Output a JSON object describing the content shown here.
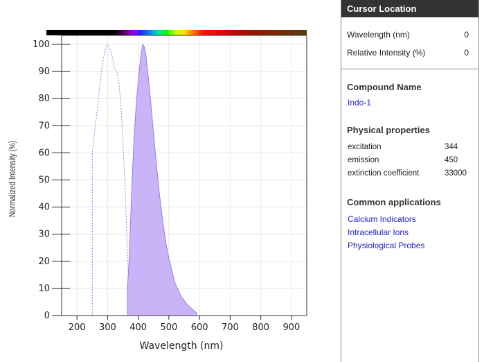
{
  "chart_data": {
    "type": "area",
    "xlabel": "Wavelength (nm)",
    "ylabel": "Normalized Intensity (%)",
    "xlim": [
      150,
      950
    ],
    "ylim": [
      0,
      100
    ],
    "xticks": [
      200,
      300,
      400,
      500,
      600,
      700,
      800,
      900
    ],
    "yticks": [
      0,
      10,
      20,
      30,
      40,
      50,
      60,
      70,
      80,
      90,
      100
    ],
    "grid": true,
    "spectrum_bar": true,
    "series": [
      {
        "style": "dotted-line",
        "color": "#9a7ae8",
        "x": [
          250,
          250,
          255,
          262,
          270,
          280,
          290,
          298,
          305,
          312,
          318,
          322,
          330,
          338,
          345,
          352,
          358,
          362,
          365,
          368,
          372,
          378,
          385,
          392,
          400,
          408
        ],
        "y": [
          0,
          60,
          65,
          72,
          80,
          90,
          97,
          100,
          99,
          97,
          94,
          91,
          90,
          85,
          75,
          60,
          45,
          32,
          22,
          14,
          8,
          4,
          2,
          1,
          0.5,
          0
        ]
      },
      {
        "style": "filled-area",
        "color": "#9a7ae8",
        "fill": "#c9b4f8",
        "x": [
          365,
          365,
          370,
          375,
          380,
          385,
          390,
          395,
          400,
          405,
          410,
          415,
          420,
          425,
          430,
          440,
          450,
          460,
          470,
          480,
          490,
          500,
          520,
          540,
          560,
          580,
          590,
          590
        ],
        "y": [
          0,
          10,
          20,
          35,
          50,
          62,
          72,
          80,
          86,
          92,
          97,
          100,
          99,
          96,
          91,
          80,
          67,
          55,
          44,
          35,
          27,
          21,
          12,
          7,
          4,
          2,
          1,
          0
        ]
      }
    ]
  },
  "cursor": {
    "title": "Cursor Location",
    "wavelength_label": "Wavelength (nm)",
    "wavelength_value": "0",
    "intensity_label": "Relative Intensity (%)",
    "intensity_value": "0"
  },
  "compound": {
    "title": "Compound Name",
    "name": "Indo-1"
  },
  "physical": {
    "title": "Physical properties",
    "rows": [
      {
        "label": "excitation",
        "value": "344"
      },
      {
        "label": "emission",
        "value": "450"
      },
      {
        "label": "extinction coefficient",
        "value": "33000"
      }
    ]
  },
  "applications": {
    "title": "Common applications",
    "items": [
      "Calcium Indicators",
      "Intracellular Ions",
      "Physiological Probes"
    ]
  }
}
